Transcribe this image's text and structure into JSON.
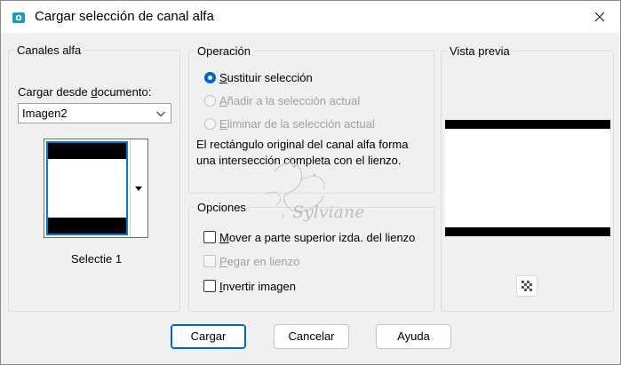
{
  "window": {
    "title": "Cargar selección de canal alfa",
    "icons": {
      "app": "selection-icon",
      "close": "close-icon"
    }
  },
  "alpha_channels": {
    "group_label": "Canales alfa",
    "load_from_label_pre": "Cargar desde ",
    "load_from_label_accel": "d",
    "load_from_label_post": "ocumento:",
    "document_value": "Imagen2",
    "thumbnail_caption": "Selectie 1"
  },
  "operation": {
    "group_label": "Operación",
    "options": [
      {
        "accel": "S",
        "rest": "ustituir selección",
        "checked": true,
        "enabled": true
      },
      {
        "accel": "A",
        "rest": "ñadir a la selección actual",
        "checked": false,
        "enabled": false
      },
      {
        "accel": "E",
        "rest": "liminar de la selección actual",
        "checked": false,
        "enabled": false
      }
    ],
    "description": "El rectángulo original del canal alfa forma una intersección completa con el lienzo."
  },
  "options": {
    "group_label": "Opciones",
    "items": [
      {
        "accel": "M",
        "rest": "over a parte superior izda. del lienzo",
        "checked": false,
        "enabled": true
      },
      {
        "accel": "P",
        "rest": "egar en lienzo",
        "checked": false,
        "enabled": false
      },
      {
        "accel": "I",
        "rest": "nvertir imagen",
        "checked": false,
        "enabled": true
      }
    ]
  },
  "preview": {
    "group_label": "Vista previa"
  },
  "buttons": {
    "load": "Cargar",
    "cancel": "Cancelar",
    "help": "Ayuda"
  },
  "watermark": "Sylviane",
  "colors": {
    "accent": "#0067c0",
    "selection_border": "#0078d4"
  }
}
